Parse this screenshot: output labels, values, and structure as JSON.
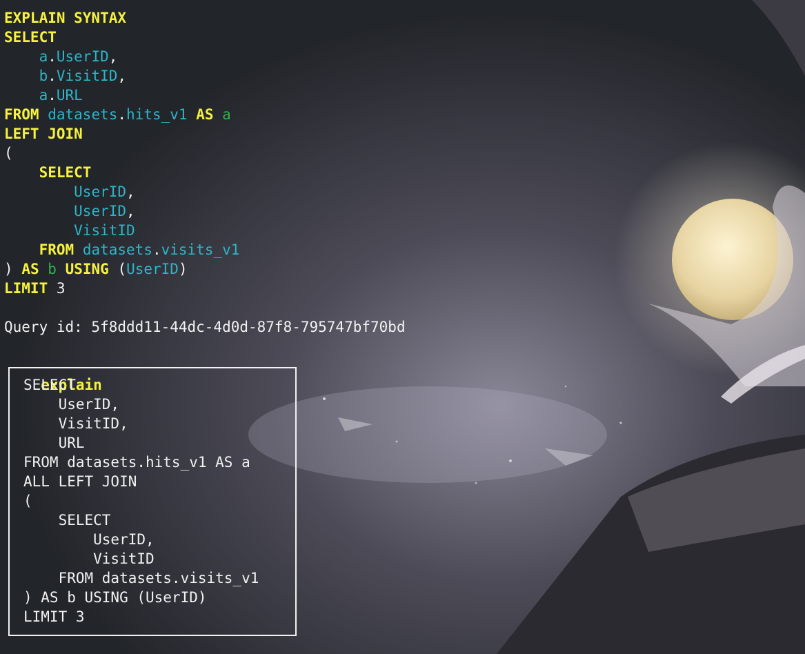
{
  "query_lines": [
    [
      {
        "t": "EXPLAIN SYNTAX",
        "c": "kw"
      }
    ],
    [
      {
        "t": "SELECT",
        "c": "kw"
      }
    ],
    [
      {
        "t": "    ",
        "c": "pl"
      },
      {
        "t": "a",
        "c": "id"
      },
      {
        "t": ".",
        "c": "pl"
      },
      {
        "t": "UserID",
        "c": "id"
      },
      {
        "t": ",",
        "c": "pl"
      }
    ],
    [
      {
        "t": "    ",
        "c": "pl"
      },
      {
        "t": "b",
        "c": "id"
      },
      {
        "t": ".",
        "c": "pl"
      },
      {
        "t": "VisitID",
        "c": "id"
      },
      {
        "t": ",",
        "c": "pl"
      }
    ],
    [
      {
        "t": "    ",
        "c": "pl"
      },
      {
        "t": "a",
        "c": "id"
      },
      {
        "t": ".",
        "c": "pl"
      },
      {
        "t": "URL",
        "c": "id"
      }
    ],
    [
      {
        "t": "FROM",
        "c": "kw"
      },
      {
        "t": " ",
        "c": "pl"
      },
      {
        "t": "datasets",
        "c": "id"
      },
      {
        "t": ".",
        "c": "pl"
      },
      {
        "t": "hits_v1",
        "c": "id"
      },
      {
        "t": " ",
        "c": "pl"
      },
      {
        "t": "AS",
        "c": "kw"
      },
      {
        "t": " ",
        "c": "pl"
      },
      {
        "t": "a",
        "c": "al"
      }
    ],
    [
      {
        "t": "LEFT JOIN",
        "c": "kw"
      }
    ],
    [
      {
        "t": "(",
        "c": "pl"
      }
    ],
    [
      {
        "t": "    ",
        "c": "pl"
      },
      {
        "t": "SELECT",
        "c": "kw"
      }
    ],
    [
      {
        "t": "        ",
        "c": "pl"
      },
      {
        "t": "UserID",
        "c": "id"
      },
      {
        "t": ",",
        "c": "pl"
      }
    ],
    [
      {
        "t": "        ",
        "c": "pl"
      },
      {
        "t": "UserID",
        "c": "id"
      },
      {
        "t": ",",
        "c": "pl"
      }
    ],
    [
      {
        "t": "        ",
        "c": "pl"
      },
      {
        "t": "VisitID",
        "c": "id"
      }
    ],
    [
      {
        "t": "    ",
        "c": "pl"
      },
      {
        "t": "FROM",
        "c": "kw"
      },
      {
        "t": " ",
        "c": "pl"
      },
      {
        "t": "datasets",
        "c": "id"
      },
      {
        "t": ".",
        "c": "pl"
      },
      {
        "t": "visits_v1",
        "c": "id"
      }
    ],
    [
      {
        "t": ")",
        "c": "pl"
      },
      {
        "t": " ",
        "c": "pl"
      },
      {
        "t": "AS",
        "c": "kw"
      },
      {
        "t": " ",
        "c": "pl"
      },
      {
        "t": "b",
        "c": "al"
      },
      {
        "t": " ",
        "c": "pl"
      },
      {
        "t": "USING",
        "c": "kw"
      },
      {
        "t": " (",
        "c": "pl"
      },
      {
        "t": "UserID",
        "c": "id"
      },
      {
        "t": ")",
        "c": "pl"
      }
    ],
    [
      {
        "t": "LIMIT",
        "c": "kw"
      },
      {
        "t": " 3",
        "c": "pl"
      }
    ],
    [
      {
        "t": "",
        "c": "pl"
      }
    ],
    [
      {
        "t": "Query id: 5f8ddd11-44dc-4d0d-87f8-795747bf70bd",
        "c": "pl"
      }
    ]
  ],
  "result": {
    "column_header": "explain",
    "rows": [
      "SELECT",
      "    UserID,",
      "    VisitID,",
      "    URL",
      "FROM datasets.hits_v1 AS a",
      "ALL LEFT JOIN",
      "(",
      "    SELECT",
      "        UserID,",
      "        VisitID",
      "    FROM datasets.visits_v1",
      ") AS b USING (UserID)",
      "LIMIT 3"
    ]
  },
  "colors": {
    "keyword": "#f6f23e",
    "identifier": "#2fb5c8",
    "alias": "#31b24a",
    "text": "#f2f2f2",
    "background": "#23262a"
  }
}
